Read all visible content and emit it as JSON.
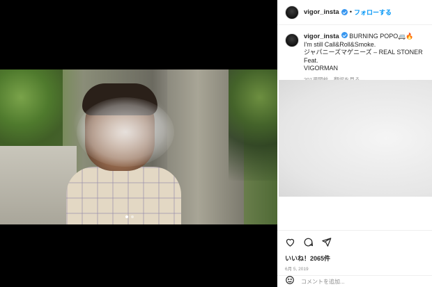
{
  "post": {
    "username": "vigor_insta",
    "follow_label": "フォローする",
    "separator": "•"
  },
  "caption": {
    "username": "vigor_insta",
    "line1": "BURNING POPO🚐🔥",
    "line2": "I'm still Call&Roll&Smoke.",
    "line3": "ジャパニーズマゲニーズ – REAL STONER Feat.",
    "line4": "VIGORMAN",
    "age": "201週間前",
    "translate_label": "翻訳を見る"
  },
  "actions": {
    "like_icon": "heart-icon",
    "comment_icon": "comment-icon",
    "share_icon": "share-icon"
  },
  "likes": "いいね！2065件",
  "date": "6月 5, 2019",
  "comment": {
    "placeholder": "コメントを追加..."
  },
  "carousel": {
    "total": 2,
    "active": 1
  },
  "colors": {
    "accent": "#0095f6",
    "verified": "#3897f0",
    "text": "#262626",
    "muted": "#8e8e8e"
  }
}
